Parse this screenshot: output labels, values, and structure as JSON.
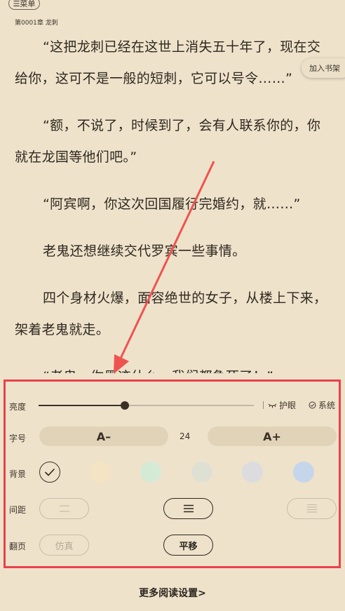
{
  "header": {
    "menu_label": "☰菜单",
    "chapter_title": "第0001章 龙刺"
  },
  "reader": {
    "paragraphs": [
      "“这把龙刺已经在这世上消失五十年了，现在交给你，这可不是一般的短刺，它可以号令……”",
      "“额，不说了，时候到了，会有人联系你的，你就在龙国等他们吧。”",
      "“阿宾啊，你这次回国履行完婚约，就……”",
      "老鬼还想继续交代罗宾一些事情。",
      "四个身材火爆，面容绝世的女子，从楼上下来，架着老鬼就走。",
      "“老鬼，你墨迹什么，我们都急死了！”"
    ],
    "add_shelf_label": "加入书架"
  },
  "settings": {
    "brightness": {
      "label": "亮度",
      "level_percent": 40,
      "eye_label": "护眼",
      "system_label": "系统"
    },
    "font_size": {
      "label": "字号",
      "decrease_label": "A–",
      "increase_label": "A+",
      "value": "24"
    },
    "background": {
      "label": "背景",
      "selected_index": 0,
      "swatches": [
        "#efe2cb",
        "#f5e4c3",
        "#d4ead7",
        "#dfe0d4",
        "#dcdcdf",
        "#c6d6ea"
      ]
    },
    "spacing": {
      "label": "间距",
      "selected_index": 1
    },
    "page_turn": {
      "label": "翻页",
      "options": [
        "仿真",
        "平移"
      ],
      "selected_index": 1
    },
    "more_label": "更多阅读设置>"
  },
  "colors": {
    "background": "#efe2cb",
    "text": "#2c261e",
    "highlight": "#e8424b"
  }
}
